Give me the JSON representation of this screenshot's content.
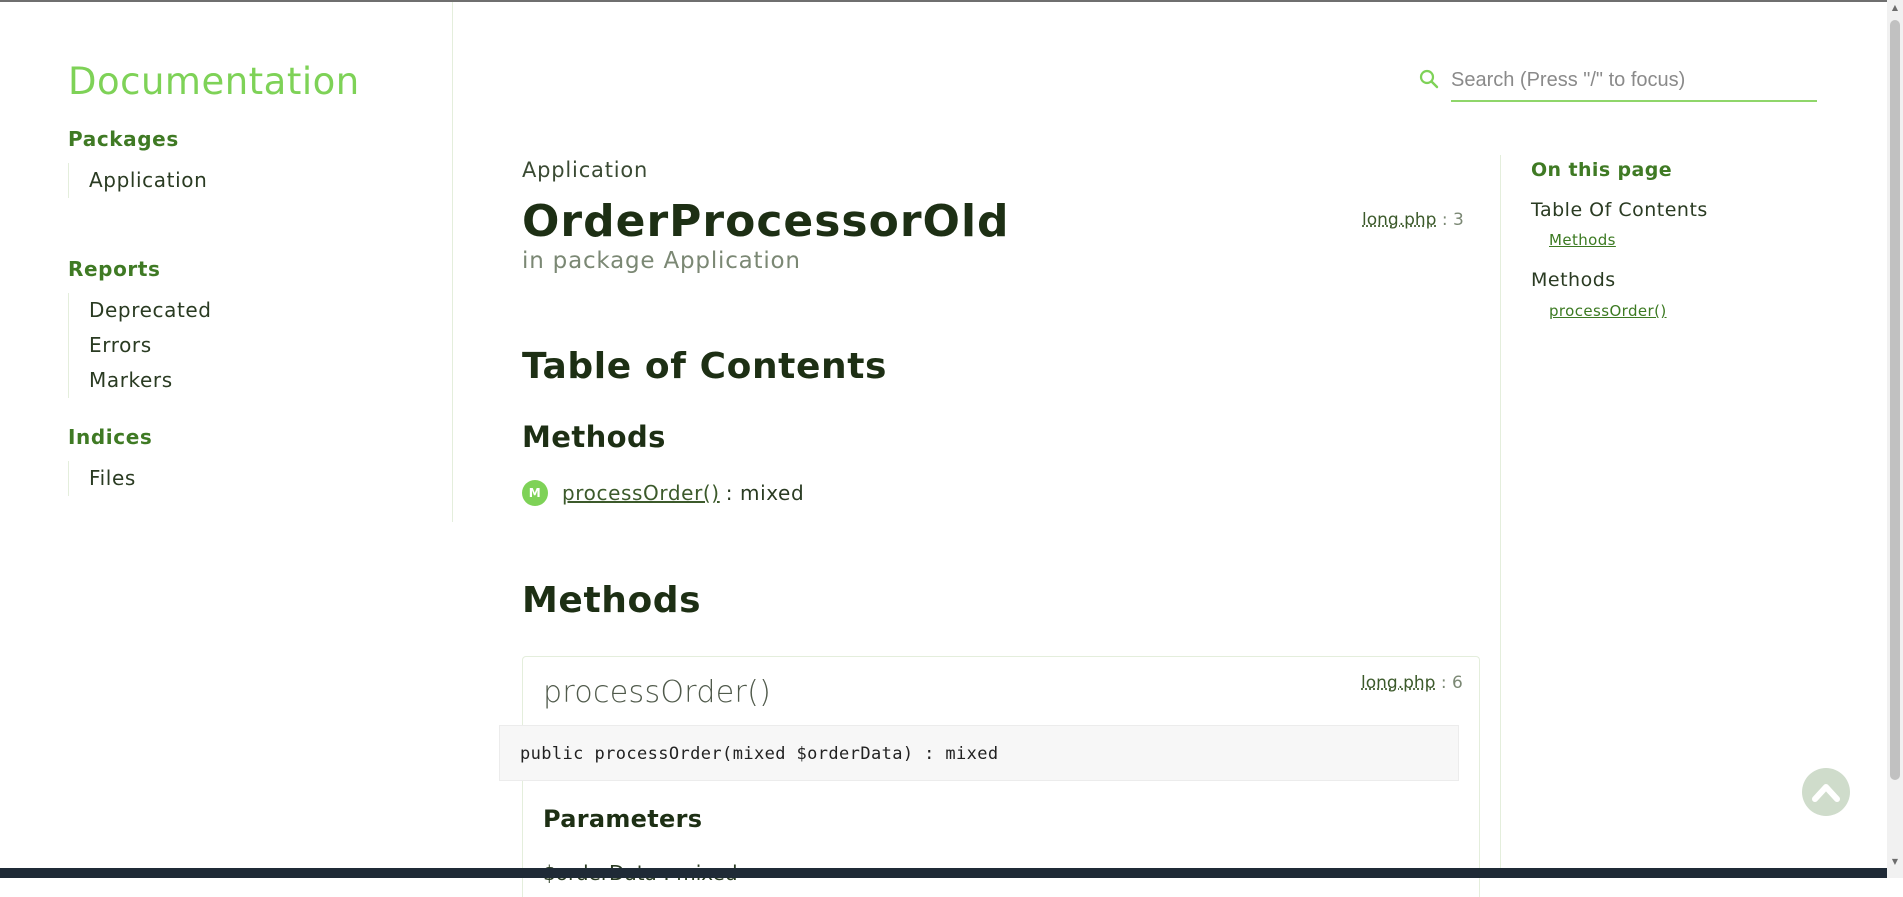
{
  "brand": "Documentation",
  "sidebar": {
    "sections": [
      {
        "heading": "Packages",
        "items": [
          "Application"
        ]
      },
      {
        "heading": "Reports",
        "items": [
          "Deprecated",
          "Errors",
          "Markers"
        ]
      },
      {
        "heading": "Indices",
        "items": [
          "Files"
        ]
      }
    ]
  },
  "search": {
    "placeholder": "Search (Press \"/\" to focus)"
  },
  "header": {
    "breadcrumb": "Application",
    "title": "OrderProcessorOld",
    "subtitle": "in package Application",
    "file": "long.php",
    "file_line": ": 3"
  },
  "toc": {
    "heading": "Table of Contents",
    "methods_heading": "Methods",
    "entries": [
      {
        "badge": "M",
        "name": "processOrder()",
        "type": ": mixed"
      }
    ]
  },
  "methods": {
    "heading": "Methods",
    "items": [
      {
        "name": "processOrder()",
        "file": "long.php",
        "file_line": ": 6",
        "signature": "public processOrder(mixed $orderData) : mixed",
        "params_heading": "Parameters",
        "param": "$orderData : mixed"
      }
    ]
  },
  "onpage": {
    "heading": "On this page",
    "toc_label": "Table Of Contents",
    "toc_sub": "Methods",
    "methods_label": "Methods",
    "methods_sub": "processOrder()"
  },
  "colors": {
    "accent": "#7ed257",
    "heading": "#3f7a24",
    "text": "#1d2f14"
  },
  "icons": {
    "search": "search-icon",
    "back_to_top": "chevron-up-icon"
  }
}
